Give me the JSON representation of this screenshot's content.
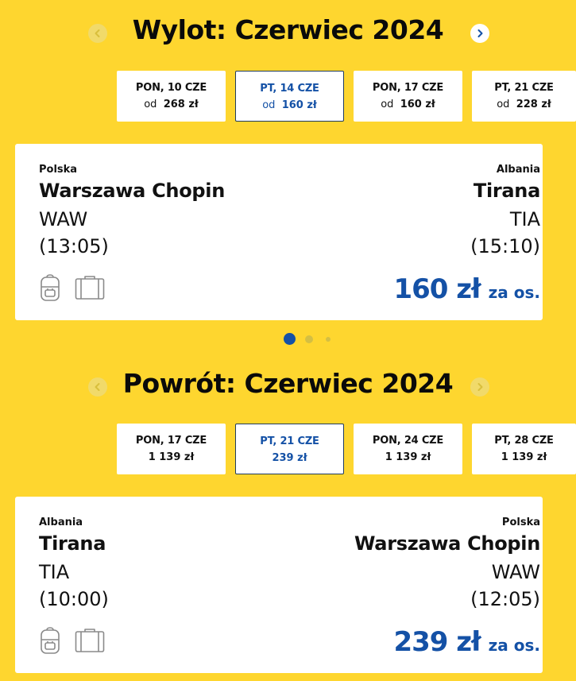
{
  "outbound": {
    "title": "Wylot: Czerwiec 2024",
    "dates": [
      {
        "day": "PON, 10 CZE",
        "prefix": "od",
        "price": "268 zł",
        "selected": false
      },
      {
        "day": "PT, 14 CZE",
        "prefix": "od",
        "price": "160 zł",
        "selected": true
      },
      {
        "day": "PON, 17 CZE",
        "prefix": "od",
        "price": "160 zł",
        "selected": false
      },
      {
        "day": "PT, 21 CZE",
        "prefix": "od",
        "price": "228 zł",
        "selected": false
      }
    ],
    "flight": {
      "from_country": "Polska",
      "from_city": "Warszawa Chopin",
      "from_code": "WAW",
      "from_time": "(13:05)",
      "to_country": "Albania",
      "to_city": "Tirana",
      "to_code": "TIA",
      "to_time": "(15:10)",
      "price": "160 zł",
      "per": "za os."
    }
  },
  "carousel": {
    "dots": 3,
    "active": 0
  },
  "return": {
    "title": "Powrót: Czerwiec 2024",
    "dates": [
      {
        "day": "PON, 17 CZE",
        "prefix": "",
        "price": "1 139 zł",
        "selected": false
      },
      {
        "day": "PT, 21 CZE",
        "prefix": "",
        "price": "239 zł",
        "selected": true
      },
      {
        "day": "PON, 24 CZE",
        "prefix": "",
        "price": "1 139 zł",
        "selected": false
      },
      {
        "day": "PT, 28 CZE",
        "prefix": "",
        "price": "1 139 zł",
        "selected": false
      }
    ],
    "flight": {
      "from_country": "Albania",
      "from_city": "Tirana",
      "from_code": "TIA",
      "from_time": "(10:00)",
      "to_country": "Polska",
      "to_city": "Warszawa Chopin",
      "to_code": "WAW",
      "to_time": "(12:05)",
      "price": "239 zł",
      "per": "za os."
    }
  },
  "icons": {
    "prev": "chevron-left-icon",
    "next": "chevron-right-icon",
    "backpack": "backpack-icon",
    "suitcase": "suitcase-icon"
  },
  "colors": {
    "background": "#FED62F",
    "accent": "#1451A6",
    "selected_border": "#1F3B5E"
  }
}
